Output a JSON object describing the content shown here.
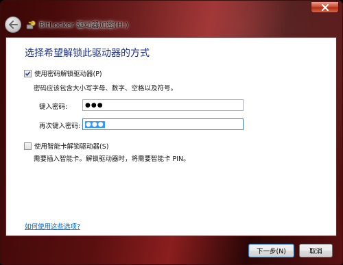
{
  "window": {
    "title": "BitLocker 驱动器加密(H:)",
    "close_icon": "close-icon",
    "back_icon": "back-arrow-icon",
    "app_icon": "bitlocker-key-icon"
  },
  "dialog": {
    "heading": "选择希望解锁此驱动器的方式",
    "password_option": {
      "label": "使用密码解锁驱动器(P)",
      "checked": true,
      "hint": "密码应该包含大小写字母、数字、空格以及符号。",
      "enter_label": "键入密码:",
      "enter_value": "●●●",
      "reenter_label": "再次键入密码:",
      "reenter_value": "●●●"
    },
    "smartcard_option": {
      "label": "使用智能卡解锁驱动器(S)",
      "checked": false,
      "hint": "需要插入智能卡。解锁驱动器时，将需要智能卡 PIN。"
    },
    "help_link": "如何使用这些选项?"
  },
  "buttons": {
    "next": "下一步(N)",
    "cancel": "取消"
  }
}
